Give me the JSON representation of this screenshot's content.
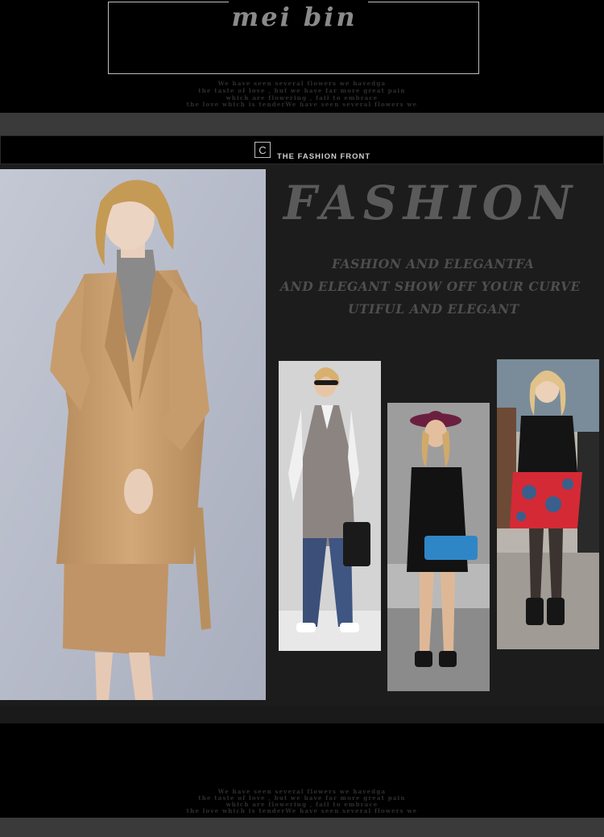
{
  "header": {
    "brand": "mei bin",
    "tagline": [
      "We have seen several flowers we havedga",
      "the taste of love , but we have far more great pain",
      "which are flowering , fail to embrace",
      "the love which is tenderWe have seen several flowers we"
    ]
  },
  "section": {
    "badge": "C",
    "title": "THE FASHION FRONT"
  },
  "hero": {
    "title": "FASHION",
    "lines": [
      "FASHION AND ELEGANTFA",
      "AND ELEGANT  SHOW OFF YOUR CURVE",
      "UTIFUL AND ELEGANT"
    ]
  },
  "footer": {
    "tagline": [
      "We have seen several flowers we havedga",
      "the taste of love , but we have far more great pain",
      "which are flowering , fail to embrace",
      "the love which is tenderWe have seen several flowers we"
    ]
  },
  "colors": {
    "background": "#000000",
    "panel": "#1c1c1c",
    "bar": "#3a3a3a",
    "coat": "#c49a6c"
  }
}
